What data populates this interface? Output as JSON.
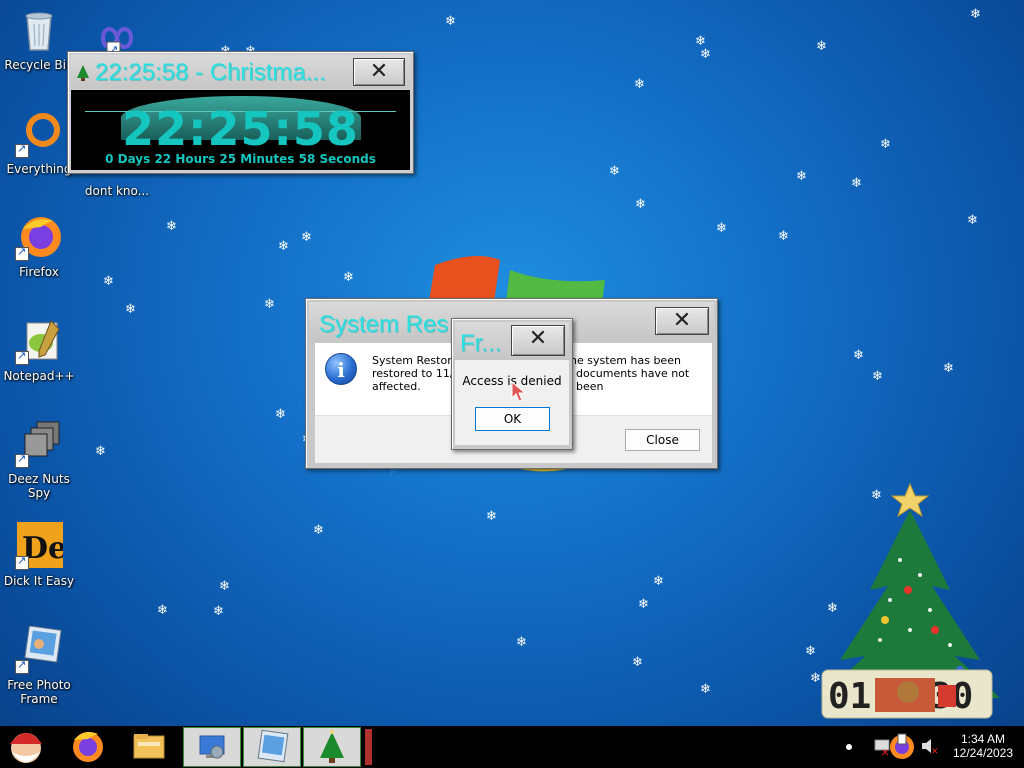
{
  "desktop": {
    "icons": [
      {
        "label": "Recycle Bin",
        "icon": "recycle-bin-icon"
      },
      {
        "label": "dont kno...",
        "icon": "infinity-app-icon"
      },
      {
        "label": "Everything",
        "icon": "everything-search-icon"
      },
      {
        "label": "Firefox",
        "icon": "firefox-icon"
      },
      {
        "label": "Notepad++",
        "icon": "notepad-plus-plus-icon"
      },
      {
        "label": "Deez Nuts Spy",
        "icon": "stacked-windows-icon"
      },
      {
        "label": "Dick It Easy",
        "icon": "de-app-icon"
      },
      {
        "label": "Free Photo Frame",
        "icon": "photo-frame-icon"
      }
    ]
  },
  "countdown": {
    "title": "22:25:58 - Christma...",
    "time": "22:25:58",
    "detail": "0 Days 22 Hours 25 Minutes 58 Seconds",
    "close_glyph": "✕"
  },
  "system_restore": {
    "title": "System Res",
    "message": "System Restore                         he system has been restored to 11/2                    documents have not been affected.",
    "message_line1_left": "System Restore",
    "message_line1_right": "he system has been",
    "message_line2_left": "restored to 11/2",
    "message_line2_right": "documents have not been",
    "message_line3": "affected.",
    "close_button": "Close",
    "close_glyph": "✕",
    "icon": "info-icon"
  },
  "access_denied": {
    "title": "Fr...",
    "message": "Access is denied",
    "ok_button": "OK",
    "close_glyph": "✕"
  },
  "taskbar": {
    "start_icon": "santa-start-icon",
    "pinned": [
      "firefox-icon",
      "file-explorer-icon"
    ],
    "running": [
      "desktop-settings-icon",
      "photo-frame-icon",
      "christmas-tree-icon"
    ],
    "tray": {
      "time": "1:34 AM",
      "date": "12/24/2023",
      "icons": [
        "notification-dot-icon",
        "network-error-icon",
        "firefox-tray-icon",
        "volume-muted-icon"
      ]
    }
  },
  "colors": {
    "title_text": "#2bdfe0",
    "countdown_digits": "#14c5c0",
    "desktop_blue": "#1471c9"
  }
}
